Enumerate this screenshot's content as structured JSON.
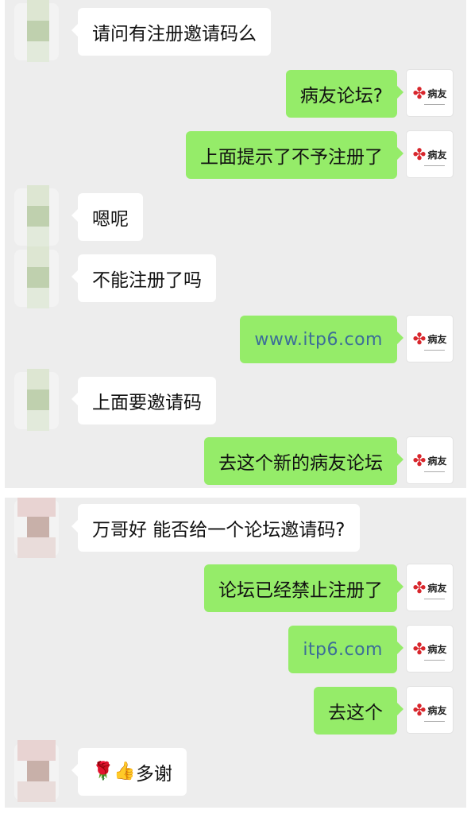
{
  "panel1": [
    {
      "side": "in",
      "avatar": "green",
      "text": "请问有注册邀请码么"
    },
    {
      "side": "out",
      "text": "病友论坛?"
    },
    {
      "side": "out",
      "text": "上面提示了不予注册了"
    },
    {
      "side": "in",
      "avatar": "green",
      "text": "嗯呢"
    },
    {
      "side": "in",
      "avatar": "green",
      "text": "不能注册了吗"
    },
    {
      "side": "out",
      "link": true,
      "text": "www.itp6.com"
    },
    {
      "side": "in",
      "avatar": "green",
      "text": "上面要邀请码"
    },
    {
      "side": "out",
      "text": "去这个新的病友论坛"
    }
  ],
  "panel2": [
    {
      "side": "in",
      "avatar": "pink",
      "text": "万哥好 能否给一个论坛邀请码?"
    },
    {
      "side": "out",
      "text": "论坛已经禁止注册了"
    },
    {
      "side": "out",
      "link": true,
      "text": "itp6.com"
    },
    {
      "side": "out",
      "text": "去这个"
    },
    {
      "side": "in",
      "avatar": "pink",
      "emoji": [
        "rose-emoji",
        "thumbs-up-emoji"
      ],
      "text": "多谢"
    }
  ],
  "own_avatar": {
    "logo_text": "病友",
    "icon": "heart-cross-logo-icon"
  },
  "colors": {
    "background": "#ededed",
    "outgoing_bubble": "#95ec69",
    "incoming_bubble": "#ffffff",
    "link": "#3c6e98"
  }
}
